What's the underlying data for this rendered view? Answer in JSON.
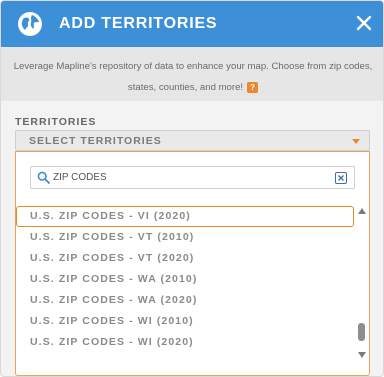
{
  "dialog": {
    "title": "ADD TERRITORIES",
    "icons": {
      "header": "globe-icon",
      "close": "close-icon",
      "search": "search-icon",
      "clear": "clear-search-icon"
    },
    "colors": {
      "header": "#3d8fd8",
      "accent": "#e8892b"
    }
  },
  "description": {
    "text": "Leverage Mapline's repository of data to enhance your map. Choose from zip codes, states, counties, and more!",
    "help_badge": "?"
  },
  "territories": {
    "label": "TERRITORIES",
    "select_placeholder": "SELECT TERRITORIES",
    "search": {
      "value": "ZIP CODES"
    },
    "options": [
      {
        "label": "U.S. ZIP CODES - VI (2020)",
        "highlighted": true
      },
      {
        "label": "U.S. ZIP CODES - VT (2010)"
      },
      {
        "label": "U.S. ZIP CODES - VT (2020)"
      },
      {
        "label": "U.S. ZIP CODES - WA (2010)"
      },
      {
        "label": "U.S. ZIP CODES - WA (2020)"
      },
      {
        "label": "U.S. ZIP CODES - WI (2010)"
      },
      {
        "label": "U.S. ZIP CODES - WI (2020)"
      }
    ]
  }
}
